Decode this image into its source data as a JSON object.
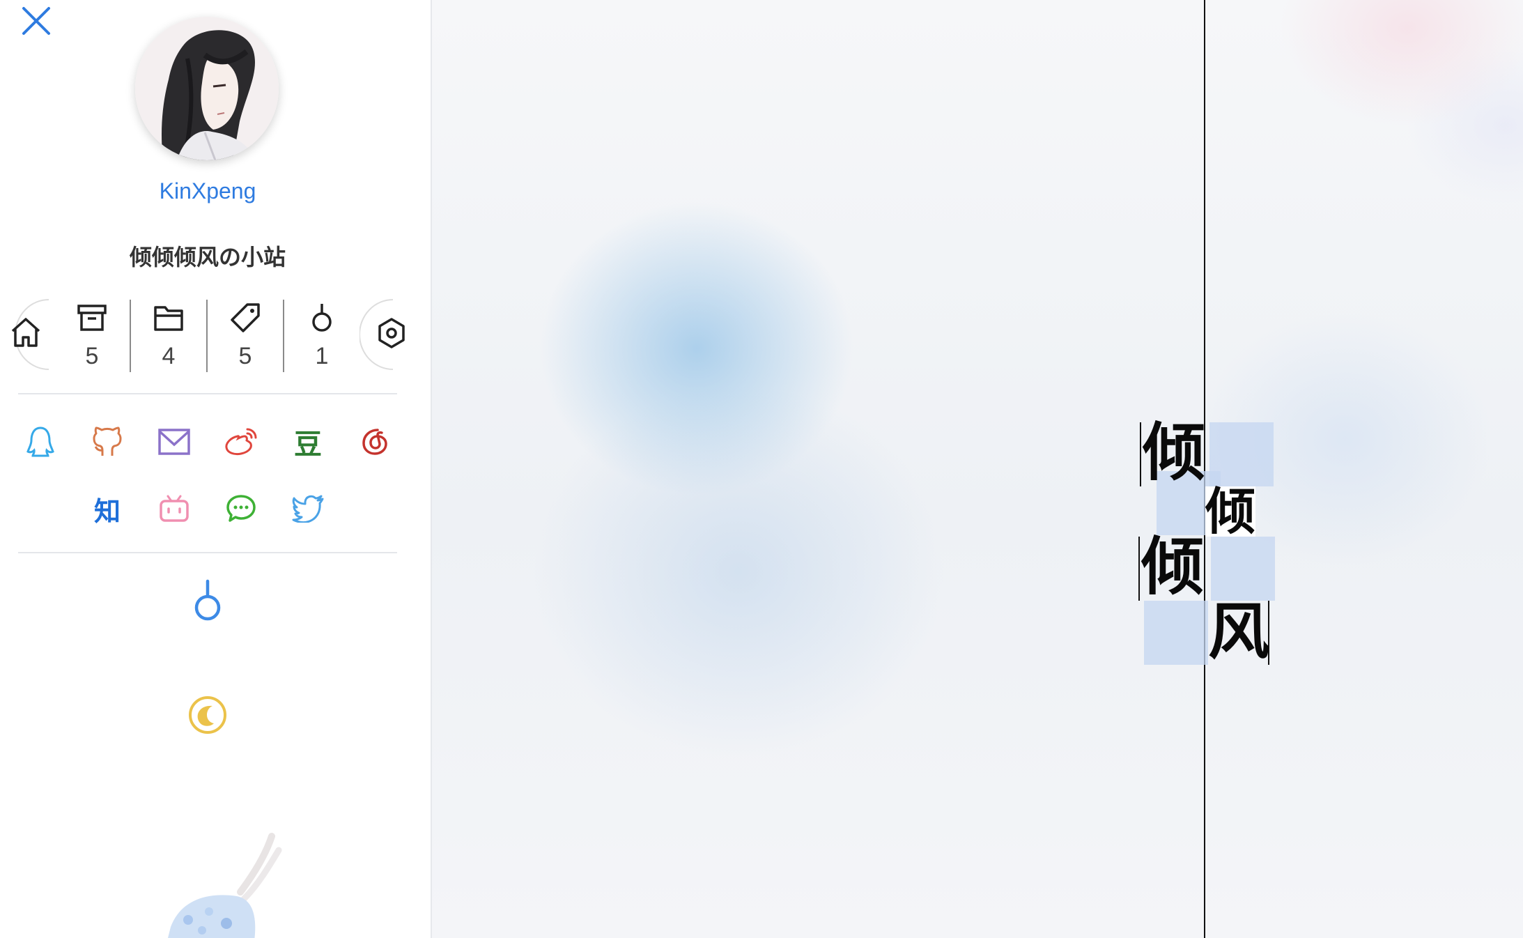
{
  "sidebar": {
    "author_name": "KinXpeng",
    "site_name": "倾倾倾风の小站",
    "stats": [
      {
        "icon": "archive-icon",
        "count": "5"
      },
      {
        "icon": "folder-icon",
        "count": "4"
      },
      {
        "icon": "tag-icon",
        "count": "5"
      },
      {
        "icon": "hook-icon",
        "count": "1"
      }
    ],
    "social_links": [
      {
        "icon": "qq-icon",
        "color": "#35a9e8"
      },
      {
        "icon": "github-icon",
        "color": "#d7794a"
      },
      {
        "icon": "email-icon",
        "color": "#8b72c9"
      },
      {
        "icon": "weibo-icon",
        "color": "#e0463d"
      },
      {
        "icon": "douban-icon",
        "text": "豆",
        "color": "#2e7d32"
      },
      {
        "icon": "netease-music-icon",
        "color": "#c4332d"
      },
      {
        "icon": "zhihu-icon",
        "text": "知",
        "color": "#1e6fd9"
      },
      {
        "icon": "bilibili-icon",
        "color": "#f08fb0"
      },
      {
        "icon": "wechat-icon",
        "color": "#3eb135"
      },
      {
        "icon": "twitter-icon",
        "color": "#4aa2e6"
      }
    ],
    "tools": [
      {
        "icon": "hook-icon",
        "color": "#3d8ae6"
      },
      {
        "icon": "moon-icon",
        "color": "#ebc24a"
      }
    ]
  },
  "hero": {
    "title_chars": [
      "倾",
      "倾",
      "倾",
      "风"
    ],
    "highlight_color": "#c4d6f0"
  },
  "colors": {
    "accent": "#2e7be0",
    "sidebar_bg": "#ffffff",
    "text": "#333333"
  }
}
